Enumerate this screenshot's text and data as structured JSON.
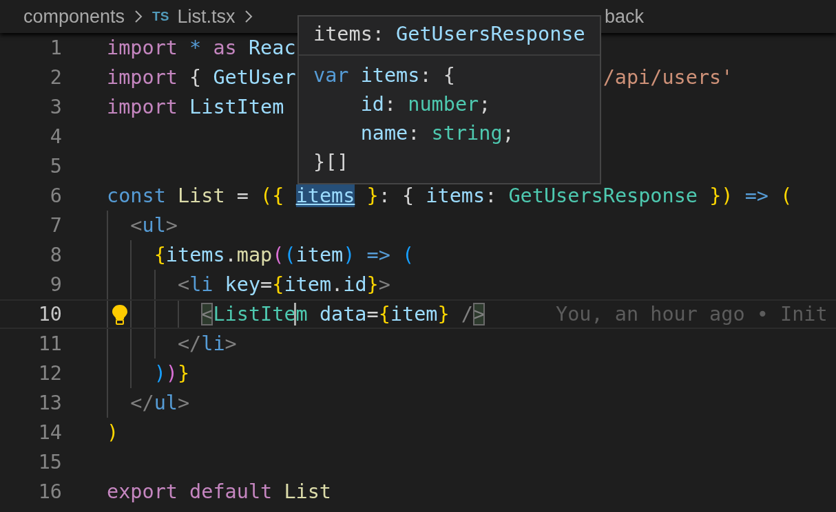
{
  "breadcrumb": {
    "items": [
      {
        "text": "components"
      },
      {
        "text": "List.tsx",
        "badge": "TS"
      }
    ],
    "tail": "back"
  },
  "editor": {
    "lines": [
      {
        "number": "1",
        "segments": [
          [
            {
              "text": "import ",
              "kind": "kw"
            },
            {
              "text": "* ",
              "kind": "st"
            },
            {
              "text": "as ",
              "kind": "kw"
            },
            {
              "text": "Reac",
              "kind": "var"
            }
          ]
        ]
      },
      {
        "number": "2",
        "segments": [
          [
            {
              "text": "import ",
              "kind": "kw"
            },
            {
              "text": "{ ",
              "kind": "pun"
            },
            {
              "text": "GetUser",
              "kind": "var"
            }
          ],
          [
            {
              "text": "/api/users'",
              "kind": "str"
            }
          ]
        ]
      },
      {
        "number": "3",
        "segments": [
          [
            {
              "text": "import ",
              "kind": "kw"
            },
            {
              "text": "ListItem",
              "kind": "var"
            }
          ]
        ]
      },
      {
        "number": "4"
      },
      {
        "number": "5"
      },
      {
        "number": "6",
        "segments": [
          [
            {
              "text": "const ",
              "kind": "st"
            },
            {
              "text": "List",
              "kind": "fn"
            },
            {
              "text": " = ",
              "kind": "pun"
            },
            {
              "text": "({ ",
              "kind": "b1"
            },
            {
              "text": "items",
              "kind": "var",
              "hovered": true
            },
            {
              "text": " }",
              "kind": "b1"
            },
            {
              "text": ": { ",
              "kind": "pun"
            },
            {
              "text": "items",
              "kind": "var"
            },
            {
              "text": ": ",
              "kind": "pun"
            },
            {
              "text": "GetUsersResponse",
              "kind": "type"
            },
            {
              "text": " })",
              "kind": "b1"
            },
            {
              "text": " => ",
              "kind": "st"
            },
            {
              "text": "(",
              "kind": "b1"
            }
          ]
        ]
      },
      {
        "number": "7",
        "segments": [
          [
            {
              "text": "  <",
              "kind": "tag"
            },
            {
              "text": "ul",
              "kind": "tagname"
            },
            {
              "text": ">",
              "kind": "tag"
            }
          ]
        ]
      },
      {
        "number": "8",
        "segments": [
          [
            {
              "text": "    {",
              "kind": "b1"
            },
            {
              "text": "items",
              "kind": "var"
            },
            {
              "text": ".",
              "kind": "pun"
            },
            {
              "text": "map",
              "kind": "fn"
            },
            {
              "text": "(",
              "kind": "b2"
            },
            {
              "text": "(",
              "kind": "b3"
            },
            {
              "text": "item",
              "kind": "var"
            },
            {
              "text": ")",
              "kind": "b3"
            },
            {
              "text": " => ",
              "kind": "st"
            },
            {
              "text": "(",
              "kind": "b3"
            }
          ]
        ]
      },
      {
        "number": "9",
        "segments": [
          [
            {
              "text": "      <",
              "kind": "tag"
            },
            {
              "text": "li ",
              "kind": "tagname"
            },
            {
              "text": "key",
              "kind": "attr"
            },
            {
              "text": "=",
              "kind": "pun"
            },
            {
              "text": "{",
              "kind": "b1"
            },
            {
              "text": "item",
              "kind": "var"
            },
            {
              "text": ".",
              "kind": "pun"
            },
            {
              "text": "id",
              "kind": "var"
            },
            {
              "text": "}",
              "kind": "b1"
            },
            {
              "text": ">",
              "kind": "tag"
            }
          ]
        ]
      },
      {
        "number": "10",
        "current": true,
        "lightbulb": true,
        "segments": [
          [
            {
              "text": "        <",
              "kind": "tag",
              "matched": true
            },
            {
              "text": "ListIte",
              "kind": "comp"
            },
            {
              "text": "m",
              "kind": "comp",
              "cursor": true
            },
            {
              "text": " data",
              "kind": "attr"
            },
            {
              "text": "=",
              "kind": "pun"
            },
            {
              "text": "{",
              "kind": "b1"
            },
            {
              "text": "item",
              "kind": "var"
            },
            {
              "text": "}",
              "kind": "b1"
            },
            {
              "text": " /",
              "kind": "tag"
            },
            {
              "text": ">",
              "kind": "tag",
              "matched": true
            }
          ]
        ],
        "blame": "You, an hour ago • Init"
      },
      {
        "number": "11",
        "segments": [
          [
            {
              "text": "      </",
              "kind": "tag"
            },
            {
              "text": "li",
              "kind": "tagname"
            },
            {
              "text": ">",
              "kind": "tag"
            }
          ]
        ]
      },
      {
        "number": "12",
        "segments": [
          [
            {
              "text": "    )",
              "kind": "b3"
            },
            {
              "text": ")",
              "kind": "b2"
            },
            {
              "text": "}",
              "kind": "b1"
            }
          ]
        ]
      },
      {
        "number": "13",
        "segments": [
          [
            {
              "text": "  </",
              "kind": "tag"
            },
            {
              "text": "ul",
              "kind": "tagname"
            },
            {
              "text": ">",
              "kind": "tag"
            }
          ]
        ]
      },
      {
        "number": "14",
        "segments": [
          [
            {
              "text": ")",
              "kind": "b1"
            }
          ]
        ]
      },
      {
        "number": "15"
      },
      {
        "number": "16",
        "segments": [
          [
            {
              "text": "export ",
              "kind": "kw"
            },
            {
              "text": "default ",
              "kind": "kw"
            },
            {
              "text": "List",
              "kind": "fn"
            }
          ]
        ]
      }
    ]
  },
  "hover": {
    "signature": [
      {
        "text": "items: ",
        "kind": "pun"
      },
      {
        "text": "GetUsersResponse",
        "kind": "var"
      }
    ],
    "body": [
      [
        {
          "text": "var ",
          "kind": "st"
        },
        {
          "text": "items",
          "kind": "var"
        },
        {
          "text": ": {",
          "kind": "pun"
        }
      ],
      [
        {
          "text": "    id",
          "kind": "var"
        },
        {
          "text": ": ",
          "kind": "pun"
        },
        {
          "text": "number",
          "kind": "type"
        },
        {
          "text": ";",
          "kind": "pun"
        }
      ],
      [
        {
          "text": "    name",
          "kind": "var"
        },
        {
          "text": ": ",
          "kind": "pun"
        },
        {
          "text": "string",
          "kind": "type"
        },
        {
          "text": ";",
          "kind": "pun"
        }
      ],
      [
        {
          "text": "}[]",
          "kind": "pun"
        }
      ]
    ]
  }
}
